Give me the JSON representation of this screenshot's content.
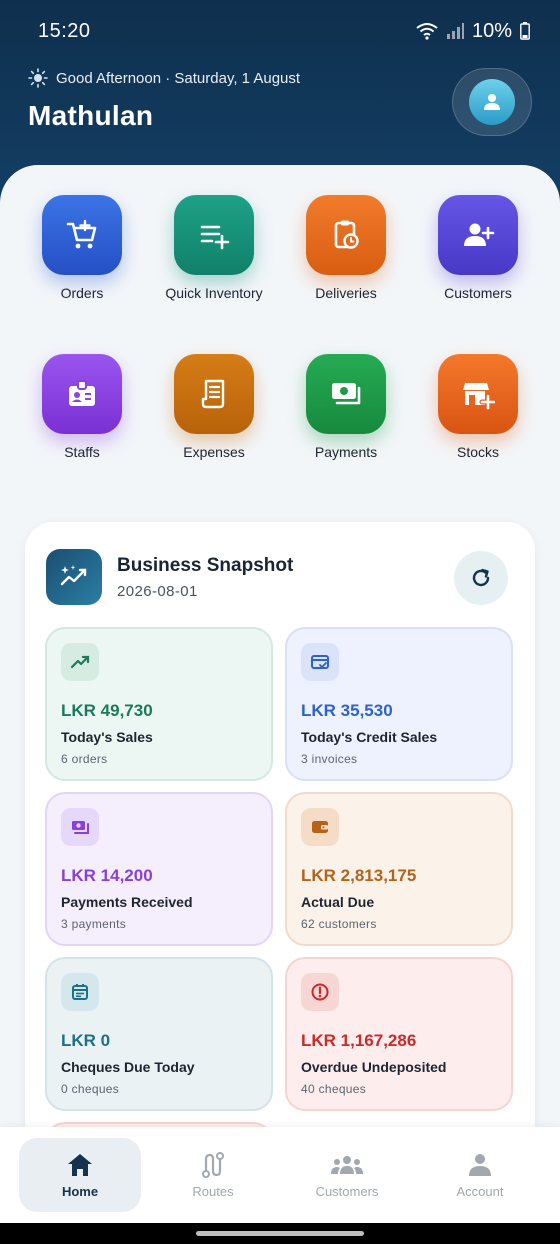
{
  "status_bar": {
    "time": "15:20",
    "battery": "10%"
  },
  "header": {
    "greeting": "Good Afternoon · Saturday, 1 August",
    "user_name": "Mathulan"
  },
  "quick_actions": [
    {
      "label": "Orders",
      "icon": "cart-add-icon",
      "color": "#2f62d6"
    },
    {
      "label": "Quick Inventory",
      "icon": "list-add-icon",
      "color": "#159379"
    },
    {
      "label": "Deliveries",
      "icon": "clipboard-clock-icon",
      "color": "#e5691c"
    },
    {
      "label": "Customers",
      "icon": "user-add-icon",
      "color": "#5547d6"
    },
    {
      "label": "Staffs",
      "icon": "id-badge-icon",
      "color": "#8a42e2"
    },
    {
      "label": "Expenses",
      "icon": "receipt-icon",
      "color": "#c8700f"
    },
    {
      "label": "Payments",
      "icon": "cash-icon",
      "color": "#1f9a48"
    },
    {
      "label": "Stocks",
      "icon": "store-add-icon",
      "color": "#e8631e"
    }
  ],
  "snapshot": {
    "title": "Business Snapshot",
    "date": "2026-08-01",
    "cards": [
      {
        "amount": "LKR 49,730",
        "label": "Today's Sales",
        "sub": "6 orders",
        "icon": "trend-up-icon",
        "color": "#1a7a5c"
      },
      {
        "amount": "LKR 35,530",
        "label": "Today's Credit Sales",
        "sub": "3 invoices",
        "icon": "credit-card-icon",
        "color": "#2d63c8"
      },
      {
        "amount": "LKR 14,200",
        "label": "Payments Received",
        "sub": "3 payments",
        "icon": "cash-icon",
        "color": "#8a3fd6"
      },
      {
        "amount": "LKR 2,813,175",
        "label": "Actual Due",
        "sub": "62 customers",
        "icon": "wallet-icon",
        "color": "#b5631b"
      },
      {
        "amount": "LKR 0",
        "label": "Cheques Due Today",
        "sub": "0 cheques",
        "icon": "calendar-icon",
        "color": "#1d7088"
      },
      {
        "amount": "LKR 1,167,286",
        "label": "Overdue Undeposited",
        "sub": "40 cheques",
        "icon": "alert-circle-icon",
        "color": "#c92a2a"
      }
    ]
  },
  "bottom_nav": [
    {
      "label": "Home",
      "icon": "home-icon",
      "active": true
    },
    {
      "label": "Routes",
      "icon": "route-icon",
      "active": false
    },
    {
      "label": "Customers",
      "icon": "group-icon",
      "active": false
    },
    {
      "label": "Account",
      "icon": "person-icon",
      "active": false
    }
  ]
}
